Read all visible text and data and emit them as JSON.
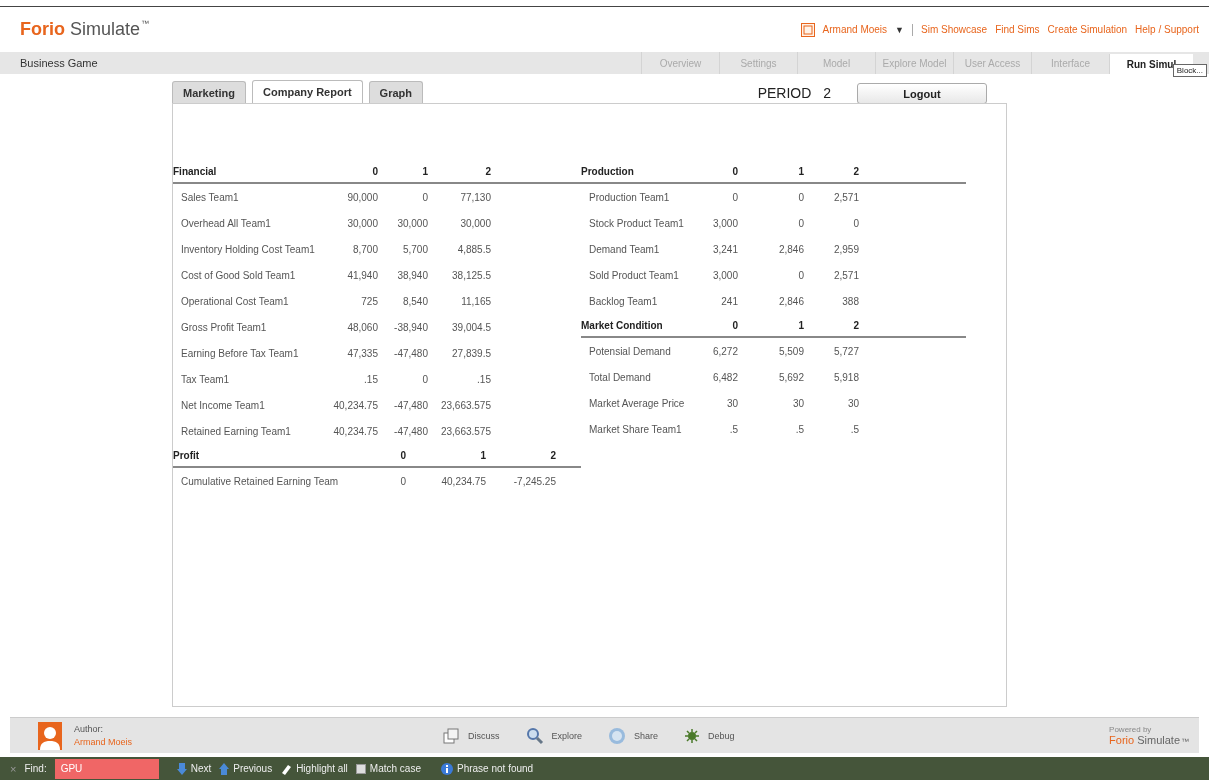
{
  "header": {
    "logo_brand": "Forio",
    "logo_product": "Simulate",
    "logo_mark": "™",
    "user": "Armand Moeis",
    "user_caret": "▼",
    "links": [
      "Sim Showcase",
      "Find Sims",
      "Create Simulation",
      "Help / Support"
    ]
  },
  "nav": {
    "title": "Business Game",
    "tabs": [
      {
        "label": "Overview",
        "selected": false
      },
      {
        "label": "Settings",
        "selected": false
      },
      {
        "label": "Model",
        "selected": false
      },
      {
        "label": "Explore Model",
        "selected": false
      },
      {
        "label": "User Access",
        "selected": false
      },
      {
        "label": "Interface",
        "selected": false
      },
      {
        "label": "Run Simul",
        "selected": true
      }
    ],
    "tooltip": "Block..."
  },
  "sim_tabs": [
    {
      "label": "Marketing",
      "selected": false
    },
    {
      "label": "Company Report",
      "selected": true
    },
    {
      "label": "Graph",
      "selected": false
    }
  ],
  "period": {
    "label": "PERIOD",
    "value": "2"
  },
  "logout": "Logout",
  "left_tables": [
    {
      "kind": "detail",
      "title": "Financial",
      "columns": [
        "0",
        "1",
        "2"
      ],
      "rows": [
        {
          "label": "Sales Team1",
          "values": [
            "90,000",
            "0",
            "77,130"
          ]
        },
        {
          "label": "Overhead All Team1",
          "values": [
            "30,000",
            "30,000",
            "30,000"
          ]
        },
        {
          "label": "Inventory Holding Cost Team1",
          "values": [
            "8,700",
            "5,700",
            "4,885.5"
          ]
        },
        {
          "label": "Cost of Good Sold Team1",
          "values": [
            "41,940",
            "38,940",
            "38,125.5"
          ]
        },
        {
          "label": "Operational Cost Team1",
          "values": [
            "725",
            "8,540",
            "11,165"
          ]
        },
        {
          "label": "Gross Profit Team1",
          "values": [
            "48,060",
            "-38,940",
            "39,004.5"
          ]
        },
        {
          "label": "Earning Before Tax Team1",
          "values": [
            "47,335",
            "-47,480",
            "27,839.5"
          ]
        },
        {
          "label": "Tax Team1",
          "values": [
            ".15",
            "0",
            ".15"
          ]
        },
        {
          "label": "Net Income Team1",
          "values": [
            "40,234.75",
            "-47,480",
            "23,663.575"
          ]
        },
        {
          "label": "Retained Earning Team1",
          "values": [
            "40,234.75",
            "-47,480",
            "23,663.575"
          ]
        }
      ]
    },
    {
      "kind": "summary",
      "title": "Profit",
      "columns": [
        "0",
        "1",
        "2"
      ],
      "rows": [
        {
          "label": "Cumulative Retained Earning Team",
          "values": [
            "0",
            "40,234.75",
            "-7,245.25"
          ]
        }
      ]
    }
  ],
  "right_tables": [
    {
      "kind": "narrow",
      "title": "Production",
      "columns": [
        "0",
        "1",
        "2"
      ],
      "rows": [
        {
          "label": "Production Team1",
          "values": [
            "0",
            "0",
            "2,571"
          ]
        },
        {
          "label": "Stock Product Team1",
          "values": [
            "3,000",
            "0",
            "0"
          ]
        },
        {
          "label": "Demand Team1",
          "values": [
            "3,241",
            "2,846",
            "2,959"
          ]
        },
        {
          "label": "Sold Product Team1",
          "values": [
            "3,000",
            "0",
            "2,571"
          ]
        },
        {
          "label": "Backlog Team1",
          "values": [
            "241",
            "2,846",
            "388"
          ]
        }
      ]
    },
    {
      "kind": "narrow",
      "title": "Market Condition",
      "columns": [
        "0",
        "1",
        "2"
      ],
      "rows": [
        {
          "label": "Potensial Demand",
          "values": [
            "6,272",
            "5,509",
            "5,727"
          ]
        },
        {
          "label": "Total Demand",
          "values": [
            "6,482",
            "5,692",
            "5,918"
          ]
        },
        {
          "label": "Market Average Price",
          "values": [
            "30",
            "30",
            "30"
          ]
        },
        {
          "label": "Market Share Team1",
          "values": [
            ".5",
            ".5",
            ".5"
          ]
        }
      ]
    }
  ],
  "footer": {
    "author_label": "Author:",
    "author_name": "Armand Moeis",
    "actions": [
      {
        "kind": "discuss",
        "label": "Discuss"
      },
      {
        "kind": "explore",
        "label": "Explore"
      },
      {
        "kind": "share",
        "label": "Share"
      },
      {
        "kind": "debug",
        "label": "Debug"
      }
    ],
    "powered_by": "Powered by",
    "brand": "Forio",
    "product": "Simulate",
    "mark": "™"
  },
  "find_bar": {
    "close": "×",
    "label": "Find:",
    "value": "GPU",
    "not_found": true,
    "next": "Next",
    "previous": "Previous",
    "highlight": "Highlight all",
    "match_case": {
      "label": "Match case",
      "checked": false
    },
    "status": "Phrase not found"
  }
}
